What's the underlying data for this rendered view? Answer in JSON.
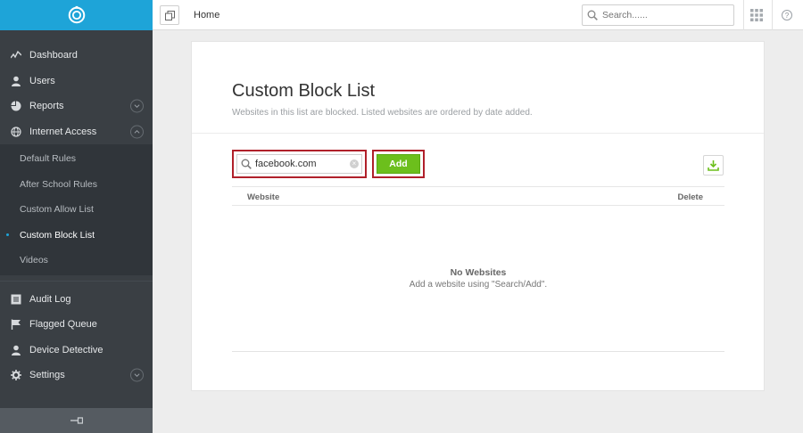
{
  "sidebar": {
    "items": [
      {
        "label": "Dashboard",
        "icon": "pulse-icon"
      },
      {
        "label": "Users",
        "icon": "user-icon"
      },
      {
        "label": "Reports",
        "icon": "pie-chart-icon"
      },
      {
        "label": "Internet Access",
        "icon": "globe-icon"
      }
    ],
    "sub_items": [
      {
        "label": "Default Rules"
      },
      {
        "label": "After School Rules"
      },
      {
        "label": "Custom Allow List"
      },
      {
        "label": "Custom Block List",
        "active": true
      },
      {
        "label": "Videos"
      }
    ],
    "items2": [
      {
        "label": "Audit Log",
        "icon": "list-icon"
      },
      {
        "label": "Flagged Queue",
        "icon": "flag-icon"
      },
      {
        "label": "Device Detective",
        "icon": "user-icon"
      },
      {
        "label": "Settings",
        "icon": "gear-icon"
      }
    ]
  },
  "topbar": {
    "breadcrumb": "Home",
    "search_placeholder": "Search......"
  },
  "page": {
    "title": "Custom Block List",
    "description": "Websites in this list are blocked. Listed websites are ordered by date added.",
    "input_value": "facebook.com",
    "add_label": "Add",
    "table": {
      "col_website": "Website",
      "col_delete": "Delete"
    },
    "empty_title": "No Websites",
    "empty_hint": "Add a website using \"Search/Add\"."
  },
  "colors": {
    "brand": "#1ea4d8",
    "sidebar_bg": "#3a3f44",
    "add_green": "#6cbf1c",
    "highlight_red": "#b0202a"
  }
}
